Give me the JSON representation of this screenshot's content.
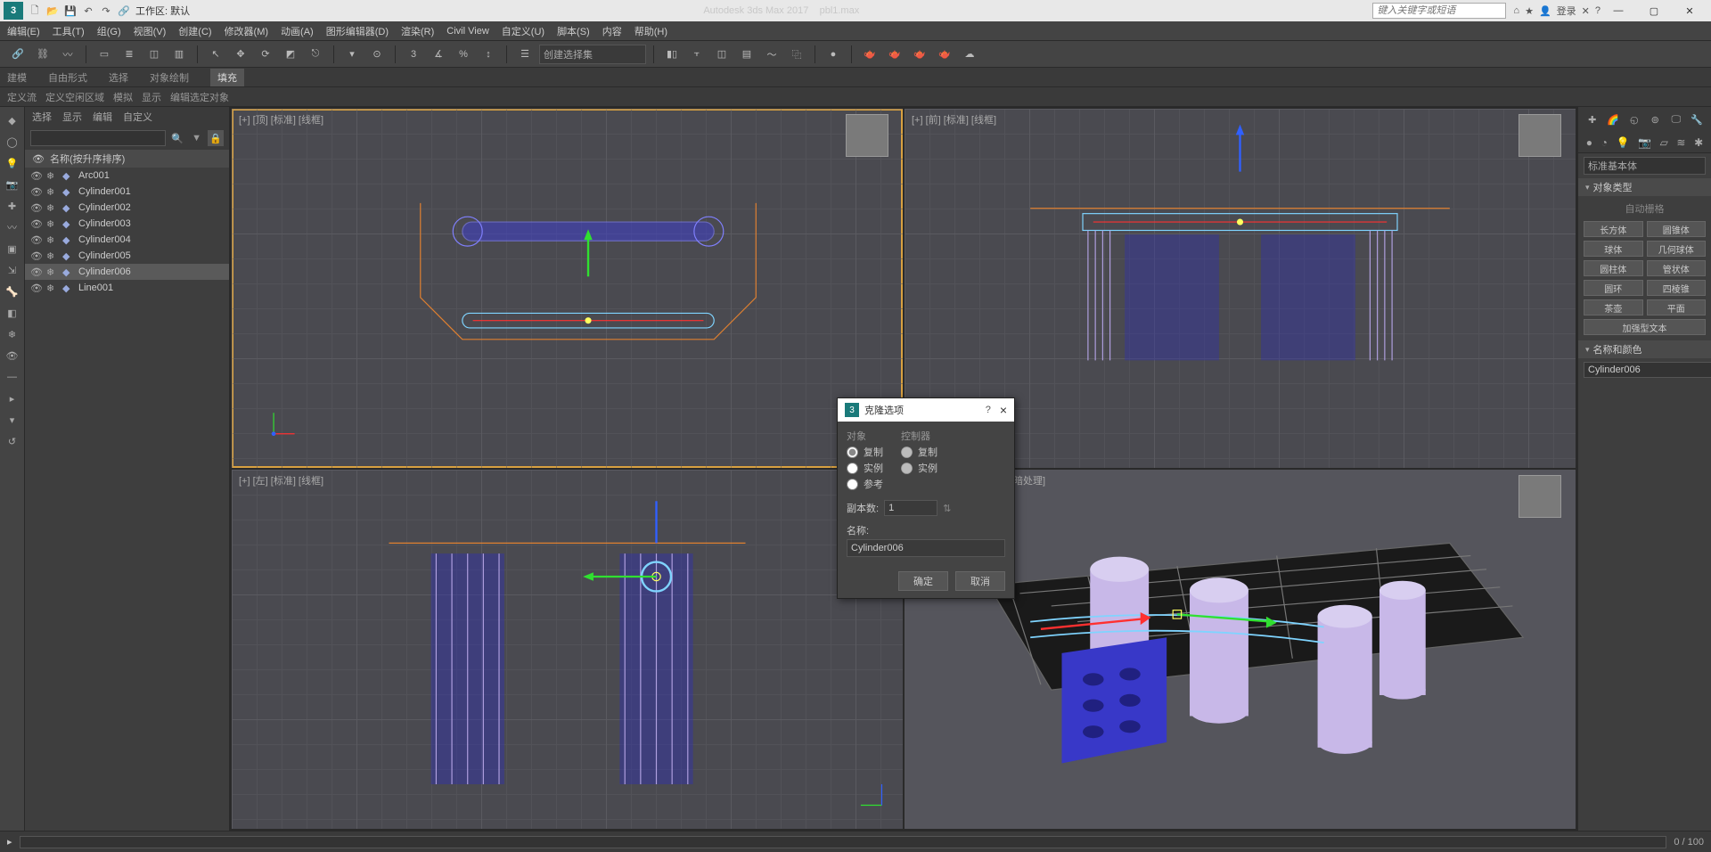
{
  "app": {
    "title_product": "Autodesk 3ds Max 2017",
    "title_file": "pbl1.max",
    "workspace_label": "工作区: 默认",
    "search_placeholder": "键入关键字或短语",
    "login": "登录"
  },
  "menu": {
    "edit": "编辑(E)",
    "tools": "工具(T)",
    "group": "组(G)",
    "views": "视图(V)",
    "create": "创建(C)",
    "modifiers": "修改器(M)",
    "animation": "动画(A)",
    "graph": "图形编辑器(D)",
    "rendering": "渲染(R)",
    "civil": "Civil View",
    "customize": "自定义(U)",
    "script": "脚本(S)",
    "content": "内容",
    "help": "帮助(H)"
  },
  "toolbar_dropdown": "创建选择集",
  "ribbon": {
    "modeling": "建模",
    "freeform": "自由形式",
    "selection": "选择",
    "object_paint": "对象绘制",
    "populate": "填充"
  },
  "subribbon": {
    "define_flow": "定义流",
    "define_idle": "定义空闲区域",
    "simulate": "模拟",
    "display": "显示",
    "edit_selected": "编辑选定对象"
  },
  "scene_tabs": {
    "select": "选择",
    "display": "显示",
    "edit": "编辑",
    "custom": "自定义"
  },
  "scene_header": "名称(按升序排序)",
  "scene_items": [
    {
      "name": "Arc001",
      "selected": false
    },
    {
      "name": "Cylinder001",
      "selected": false
    },
    {
      "name": "Cylinder002",
      "selected": false
    },
    {
      "name": "Cylinder003",
      "selected": false
    },
    {
      "name": "Cylinder004",
      "selected": false
    },
    {
      "name": "Cylinder005",
      "selected": false
    },
    {
      "name": "Cylinder006",
      "selected": true
    },
    {
      "name": "Line001",
      "selected": false
    }
  ],
  "viewports": {
    "top": "[+] [顶] [标准] [线框]",
    "front": "[+] [前] [标准] [线框]",
    "left": "[+] [左] [标准] [线框]",
    "persp": "[+] [透视] [标准] [默认明暗处理]"
  },
  "dialog": {
    "title": "克隆选项",
    "object_group": "对象",
    "controller_group": "控制器",
    "opt_copy": "复制",
    "opt_instance": "实例",
    "opt_reference": "参考",
    "copies_label": "副本数:",
    "copies_value": "1",
    "name_label": "名称:",
    "name_value": "Cylinder006",
    "ok": "确定",
    "cancel": "取消"
  },
  "command_panel": {
    "category": "标准基本体",
    "rollout_type": "对象类型",
    "autogrid": "自动栅格",
    "primitives": [
      "长方体",
      "圆锥体",
      "球体",
      "几何球体",
      "圆柱体",
      "管状体",
      "圆环",
      "四棱锥",
      "茶壶",
      "平面",
      "加强型文本"
    ],
    "rollout_name": "名称和颜色",
    "obj_name": "Cylinder006"
  },
  "timeline": {
    "frame": "0 / 100"
  },
  "colors": {
    "selection_wire": "#7fd4ff"
  }
}
